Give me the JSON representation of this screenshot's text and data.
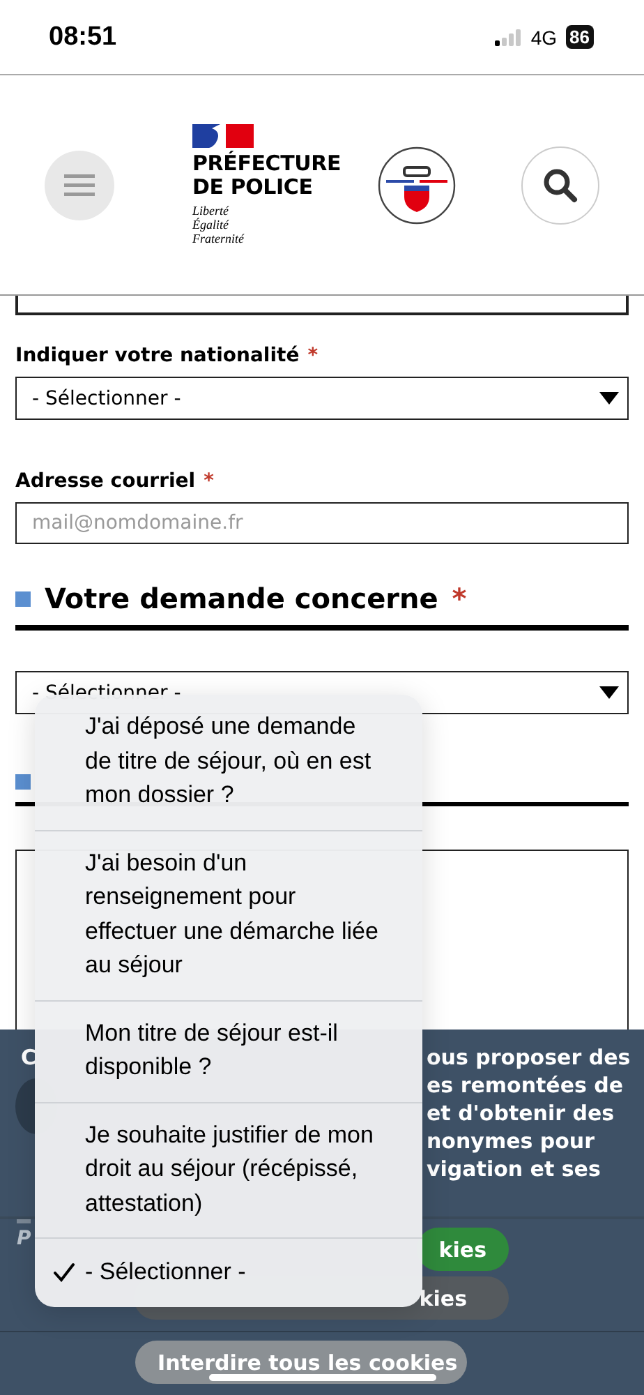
{
  "status_bar": {
    "time": "08:51",
    "network": "4G",
    "battery": "86"
  },
  "header": {
    "logo_title": [
      "PRÉFECTURE",
      "DE POLICE"
    ],
    "motto": [
      "Liberté",
      "Égalité",
      "Fraternité"
    ]
  },
  "form": {
    "nationality": {
      "label": "Indiquer votre nationalité",
      "required_mark": "*",
      "value": "- Sélectionner -"
    },
    "email": {
      "label": "Adresse courriel",
      "required_mark": "*",
      "placeholder": "mail@nomdomaine.fr"
    },
    "section": {
      "title": "Votre demande concerne",
      "required_mark": "*"
    },
    "request_select": {
      "value": "- Sélectionner -"
    }
  },
  "dropdown": {
    "options": [
      {
        "label": "J'ai déposé une demande de titre de séjour, où en est mon dossier ?",
        "selected": false
      },
      {
        "label": "J'ai besoin d'un renseignement pour effectuer une démarche liée au séjour",
        "selected": false
      },
      {
        "label": "Mon titre de séjour est-il disponible ?",
        "selected": false
      },
      {
        "label": "Je souhaite justifier de mon droit au séjour (récépissé, attestation)",
        "selected": false
      },
      {
        "label": "- Sélectionner -",
        "selected": true
      }
    ]
  },
  "cookie_banner": {
    "left_fragments": [
      "C"
    ],
    "text_lines": [
      "ous proposer des",
      "es remontées de",
      "et d'obtenir des",
      "nonymes pour",
      "vigation et ses"
    ],
    "link_fragment": "P",
    "accept_button": "kies",
    "customize_button": "kies",
    "deny_button": "Interdire tous les cookies"
  }
}
